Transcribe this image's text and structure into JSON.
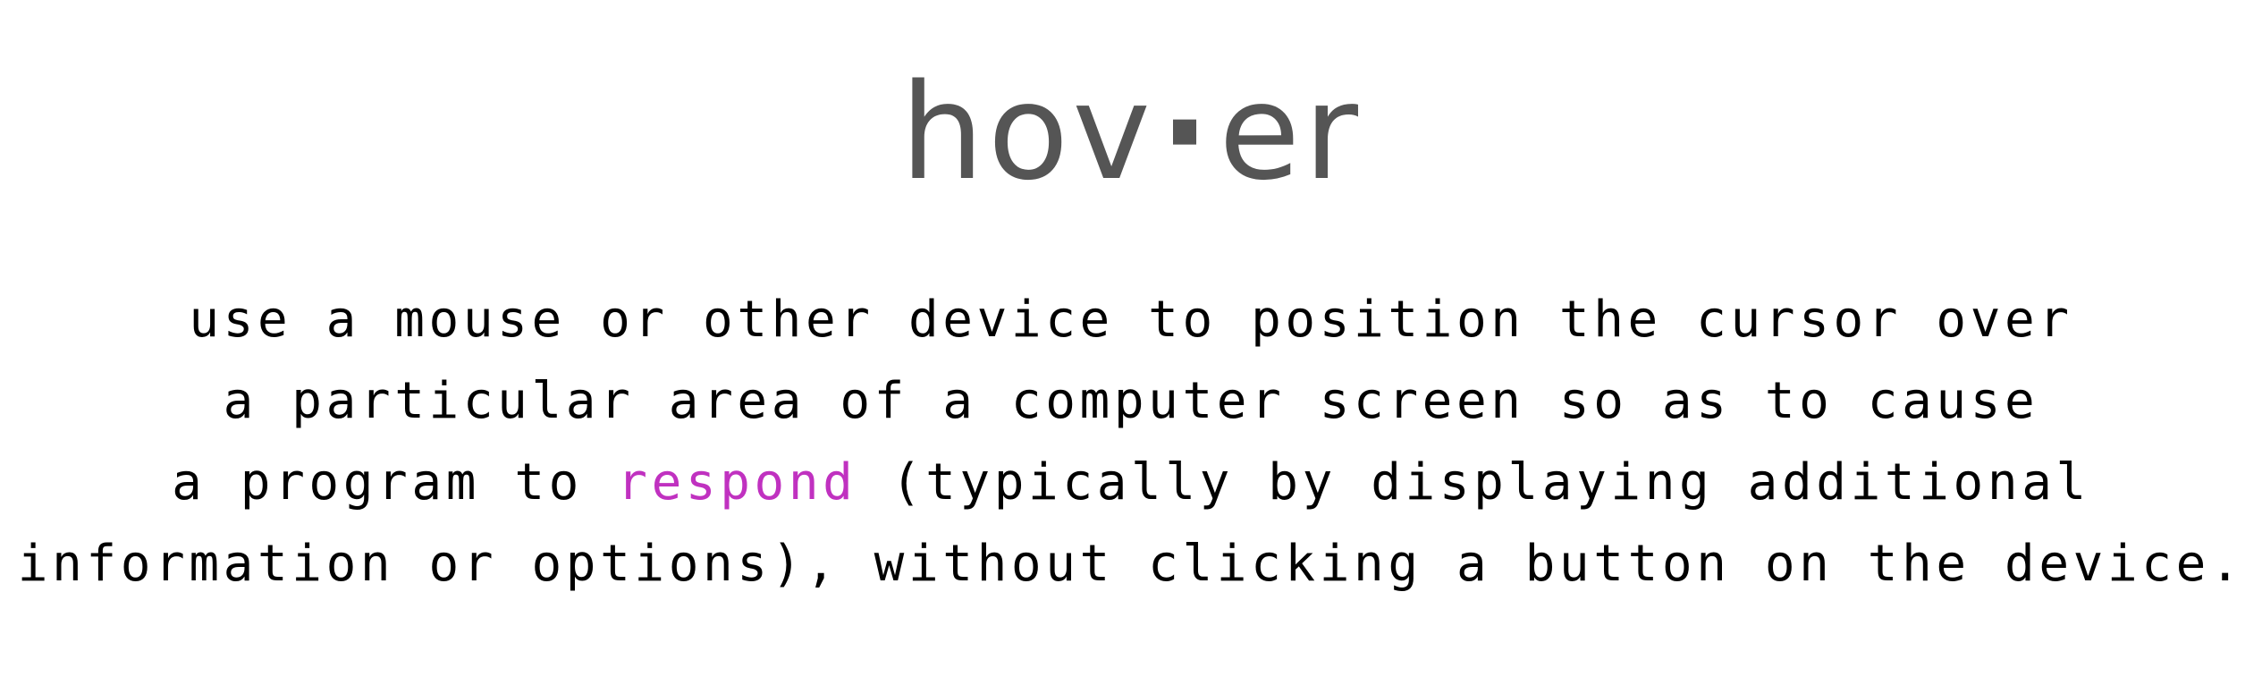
{
  "headword": {
    "part1": "hov",
    "separator": "·",
    "part2": "er",
    "color": "#555555"
  },
  "definition": {
    "line1": "use a mouse or other device to position the cursor over",
    "line2": "a particular area of a computer screen so as to cause",
    "line3_before": "a program to ",
    "line3_link": "respond",
    "line3_after": " (typically by displaying additional",
    "line4": "information or options), without clicking a button on the device.",
    "text_color": "#000000",
    "link_color": "#c031c0"
  }
}
